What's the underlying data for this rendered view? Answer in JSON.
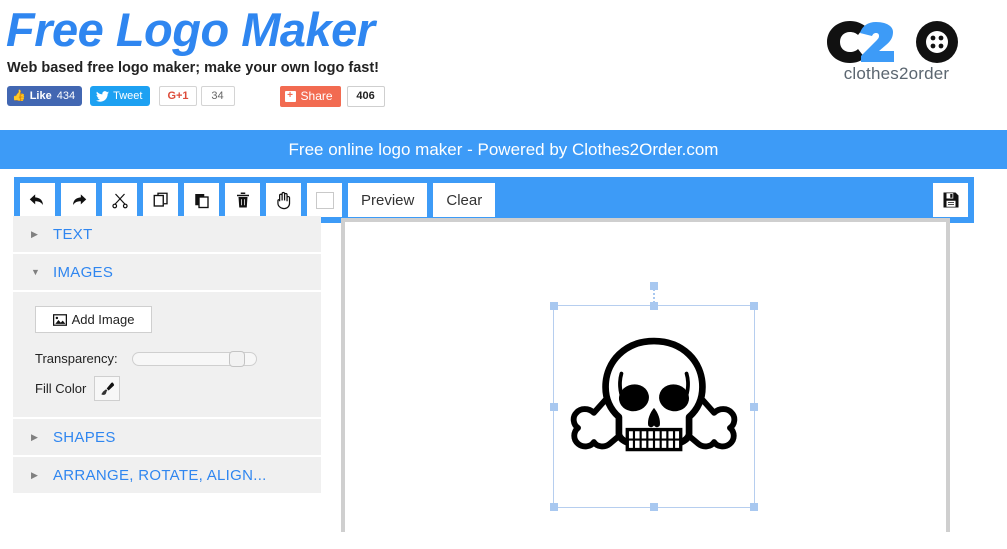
{
  "header": {
    "title": "Free Logo Maker",
    "tagline": "Web based free logo maker; make your own logo fast!",
    "social": {
      "facebook_label": "Like",
      "facebook_count": "434",
      "twitter_label": "Tweet",
      "gplus_label": "G+1",
      "gplus_count": "34",
      "share_label": "Share",
      "share_count": "406",
      "share_plus": "+"
    },
    "logo": {
      "letter_c": "C",
      "letter_2": "2",
      "letter_o": "O",
      "wordmark": "clothes2order"
    }
  },
  "banner": {
    "text": "Free online logo maker - Powered by Clothes2Order.com"
  },
  "toolbar": {
    "buttons": [
      {
        "name": "undo",
        "label": ""
      },
      {
        "name": "redo",
        "label": ""
      },
      {
        "name": "cut",
        "label": ""
      },
      {
        "name": "copy",
        "label": ""
      },
      {
        "name": "paste",
        "label": ""
      },
      {
        "name": "delete",
        "label": ""
      },
      {
        "name": "pan",
        "label": ""
      },
      {
        "name": "color-swatch",
        "label": ""
      }
    ],
    "preview_label": "Preview",
    "clear_label": "Clear",
    "save_label": ""
  },
  "sidebar": {
    "panels": [
      {
        "title": "TEXT",
        "expanded": false
      },
      {
        "title": "IMAGES",
        "expanded": true
      },
      {
        "title": "SHAPES",
        "expanded": false
      },
      {
        "title": "ARRANGE, ROTATE, ALIGN...",
        "expanded": false
      }
    ],
    "images_panel": {
      "add_image_label": "Add Image",
      "transparency_label": "Transparency:",
      "transparency_value": "78",
      "fill_color_label": "Fill Color"
    }
  },
  "canvas": {
    "selected_object": "skull-and-crossbones"
  },
  "colors": {
    "brand_blue": "#3d9bf7",
    "title_blue": "#2f86f0",
    "panel_gray": "#f0f0f0",
    "canvas_border": "#cfcfcf",
    "selection_blue": "#a8c8f0",
    "facebook_blue": "#4267b2",
    "twitter_blue": "#1da1f2",
    "gplus_red": "#dd4b39",
    "share_orange": "#f26b51"
  }
}
